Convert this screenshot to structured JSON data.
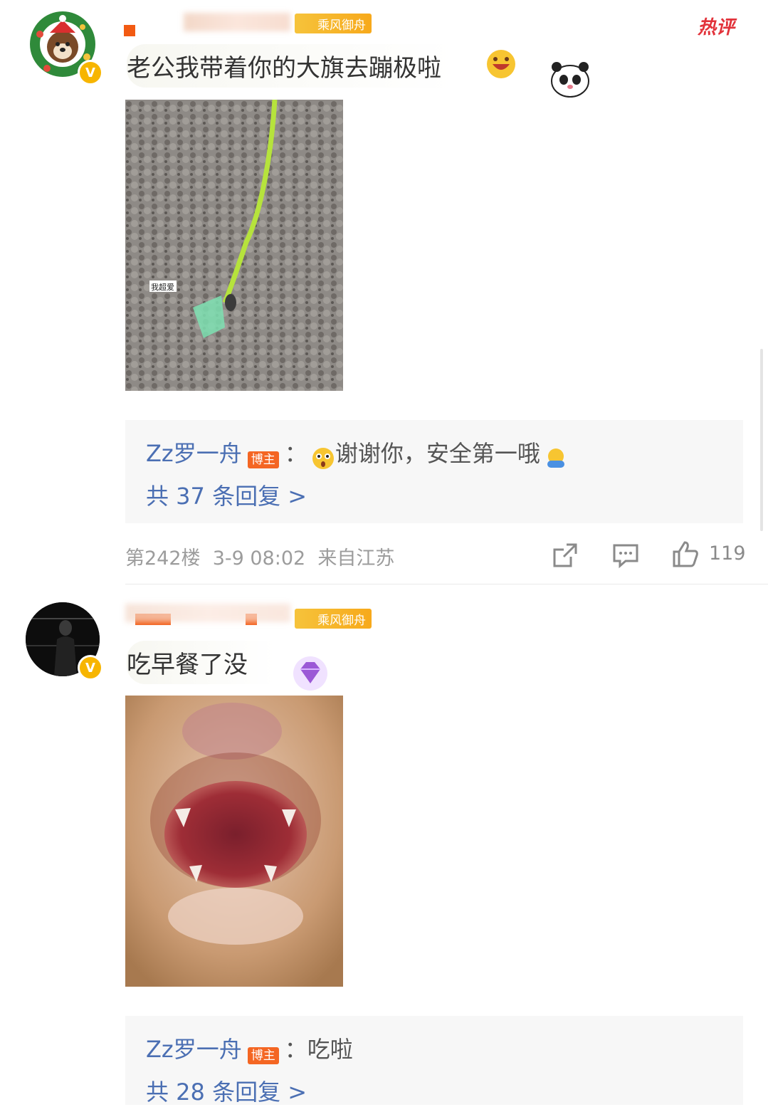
{
  "comments": [
    {
      "hot_label": "热评",
      "fan_badge": "乘风御舟",
      "text": "老公我带着你的大旗去蹦极啦",
      "photo_caption": "我超爱",
      "reply": {
        "name": "Zz罗一舟",
        "tag": "博主",
        "colon": "：",
        "text": "谢谢你，安全第一哦"
      },
      "reply_count": "共 37 条回复 >",
      "meta": "第242楼  3-9 08:02  来自江苏",
      "likes": "119"
    },
    {
      "fan_badge": "乘风御舟",
      "text": "吃早餐了没",
      "reply": {
        "name": "Zz罗一舟",
        "tag": "博主",
        "colon": "：",
        "text": "吃啦"
      },
      "reply_count": "共 28 条回复 >"
    }
  ],
  "icons": [
    "wreath-dog-avatar",
    "verified-v-icon",
    "laugh-emoji",
    "panda-decoration",
    "share-icon",
    "comment-icon",
    "like-icon",
    "purple-gem-decoration",
    "shock-emoji",
    "hug-emoji"
  ],
  "colors": {
    "accent_blue": "#4b6fb3",
    "hot_red": "#e2323a",
    "badge_orange": "#f46623",
    "fan_gold": "#f6c33b"
  }
}
